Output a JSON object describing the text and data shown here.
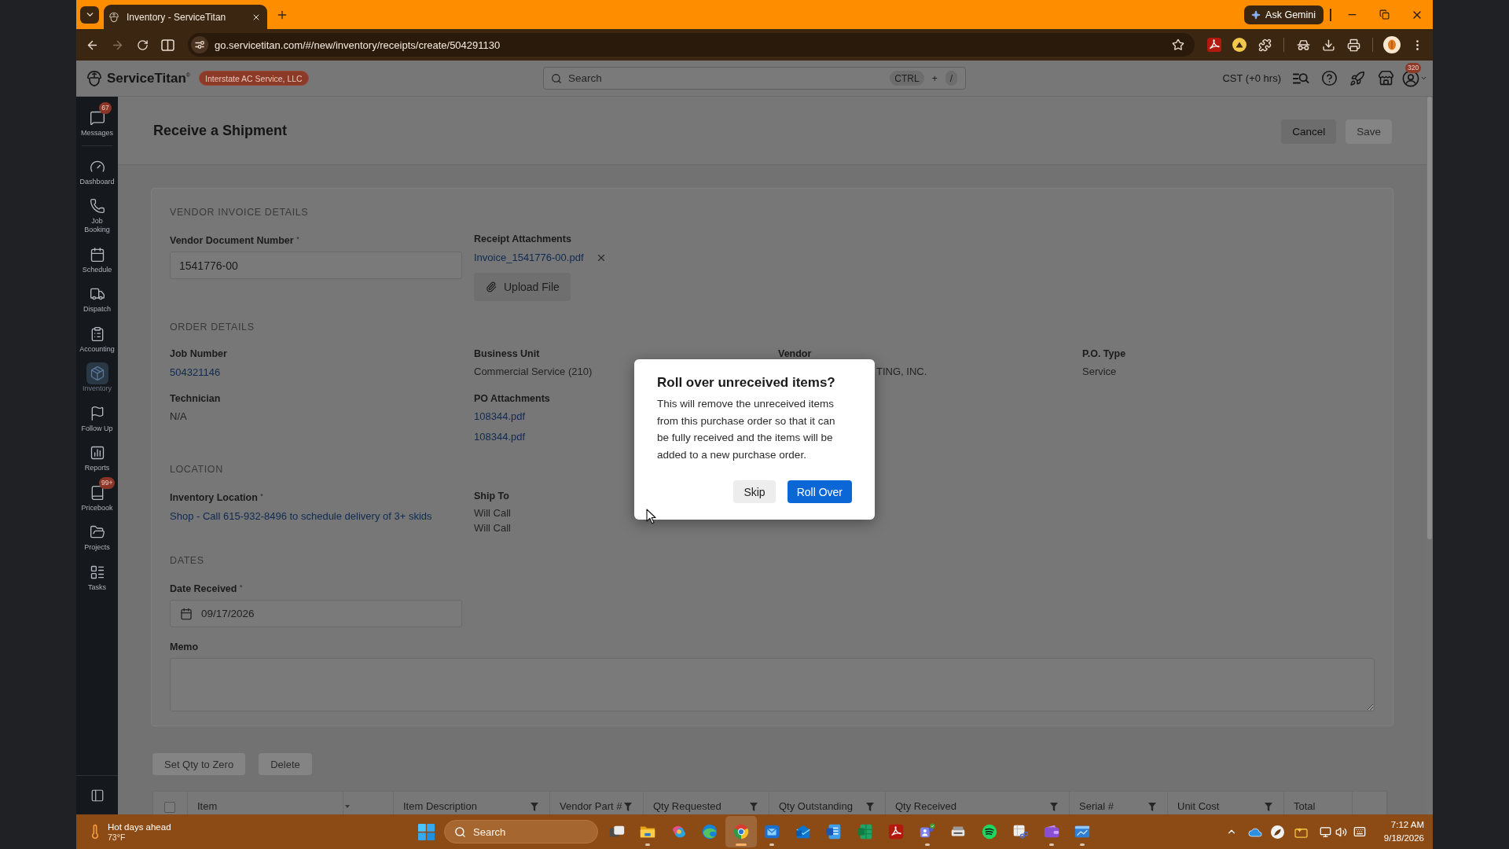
{
  "browser": {
    "tabs": [
      {
        "title": "Inventory - ServiceTitan",
        "selected": true
      }
    ],
    "forward_disabled": true,
    "url": "go.servicetitan.com/#/new/inventory/receipts/create/504291130",
    "assistant_button": "Ask Gemini"
  },
  "app_header": {
    "brand": "ServiceTitan$^{®}$",
    "company": "Interstate AC Service, LLC",
    "search": {
      "placeholder": "Search",
      "shortcut": [
        {
          "label": "CTRL",
          "kind": "key"
        },
        {
          "label": "+",
          "kind": "separator"
        },
        {
          "label": "/",
          "kind": "key"
        }
      ]
    },
    "timezone": "CST (+0 hrs)",
    "notification_count": "320"
  },
  "sidebar": {
    "items": [
      {
        "label": "Messages",
        "badge": "67",
        "selected": false
      },
      {
        "label": "Dashboard",
        "selected": false
      },
      {
        "label": "Job Booking",
        "selected": false
      },
      {
        "label": "Schedule",
        "selected": false
      },
      {
        "label": "Dispatch",
        "selected": false
      },
      {
        "label": "Accounting",
        "selected": false
      },
      {
        "label": "Inventory",
        "selected": true
      },
      {
        "label": "Follow Up",
        "selected": false
      },
      {
        "label": "Reports",
        "selected": false
      },
      {
        "label": "Pricebook",
        "badge": "99+",
        "selected": false
      },
      {
        "label": "Projects",
        "selected": false
      },
      {
        "label": "Tasks",
        "selected": false
      }
    ]
  },
  "page": {
    "title": "Receive a Shipment",
    "actions": [
      {
        "label": "Cancel",
        "disabled": false
      },
      {
        "label": "Save",
        "disabled": true
      }
    ]
  },
  "sections": [
    {
      "heading": "VENDOR INVOICE DETAILS",
      "fields": [
        {
          "kind": "input",
          "label": "Vendor Document Number $^{*}$",
          "value": "1541776-00"
        },
        {
          "kind": "attachments",
          "label": "Receipt Attachments",
          "files": [
            "Invoice_1541776-00.pdf"
          ],
          "button": "Upload File"
        }
      ]
    },
    {
      "heading": "ORDER DETAILS",
      "fields": [
        {
          "kind": "link",
          "label": "Job Number",
          "value": "504321146"
        },
        {
          "kind": "text",
          "label": "Business Unit",
          "value": "Commercial Service (210)"
        },
        {
          "kind": "covered",
          "label": "Vendor",
          "value": "TING, INC."
        },
        {
          "kind": "text",
          "label": "P.O. Type",
          "value": "Service"
        },
        {
          "kind": "text",
          "label": "Technician",
          "value": "N/A"
        },
        {
          "kind": "links",
          "label": "PO Attachments",
          "values": [
            "108344.pdf",
            "108344.pdf"
          ]
        }
      ]
    },
    {
      "heading": "LOCATION",
      "fields": [
        {
          "kind": "link",
          "label": "Inventory Location $^{*}$",
          "value": "Shop - Call 615-932-8496 to schedule delivery of 3+ skids"
        },
        {
          "kind": "lines",
          "label": "Ship To",
          "values": [
            "Will Call",
            "Will Call"
          ]
        }
      ]
    },
    {
      "heading": "DATES",
      "fields": [
        {
          "kind": "date",
          "label": "Date Received $^{*}$",
          "value": "09/17/2026"
        },
        {
          "kind": "textarea",
          "label": "Memo"
        }
      ]
    }
  ],
  "table": {
    "actions": [
      {
        "label": "Set Qty to Zero",
        "disabled": true
      },
      {
        "label": "Delete",
        "disabled": true
      }
    ],
    "select_all": {
      "checked": false
    },
    "columns": [
      {
        "label": "Item",
        "filter": false
      },
      {
        "label": "Item Description",
        "filter": true
      },
      {
        "label": "Vendor Part #",
        "filter": true
      },
      {
        "label": "Qty Requested",
        "filter": true
      },
      {
        "label": "Qty Outstanding",
        "filter": true
      },
      {
        "label": "Qty Received",
        "filter": true
      },
      {
        "label": "Serial #",
        "filter": true
      },
      {
        "label": "Unit Cost",
        "filter": true
      },
      {
        "label": "Total",
        "filter": false
      }
    ]
  },
  "dialog": {
    "title": "Roll over unreceived items?",
    "message": "This will remove the unreceived items from this purchase order so that it can be fully received and the items will be added to a new purchase order.",
    "buttons": [
      {
        "label": "Skip",
        "kind": "secondary"
      },
      {
        "label": "Roll Over",
        "kind": "primary"
      }
    ]
  },
  "taskbar": {
    "weather": {
      "title": "Hot days ahead",
      "temperature": "73°F"
    },
    "search": {
      "placeholder": "Search"
    },
    "apps": [
      {
        "running": false,
        "selected": false
      },
      {
        "running": true,
        "selected": false
      },
      {
        "running": false,
        "selected": false
      },
      {
        "running": false,
        "selected": false
      },
      {
        "running": true,
        "selected": true
      },
      {
        "running": true,
        "selected": false
      },
      {
        "running": false,
        "selected": false
      },
      {
        "running": false,
        "selected": false
      },
      {
        "running": false,
        "selected": false
      },
      {
        "running": false,
        "selected": false
      },
      {
        "running": true,
        "selected": false
      },
      {
        "running": false,
        "selected": false
      },
      {
        "running": false,
        "selected": false
      },
      {
        "running": false,
        "selected": false
      },
      {
        "running": true,
        "selected": false
      },
      {
        "running": true,
        "selected": false
      }
    ],
    "clock": {
      "time": "7:12 AM",
      "date": "9/18/2026"
    }
  }
}
